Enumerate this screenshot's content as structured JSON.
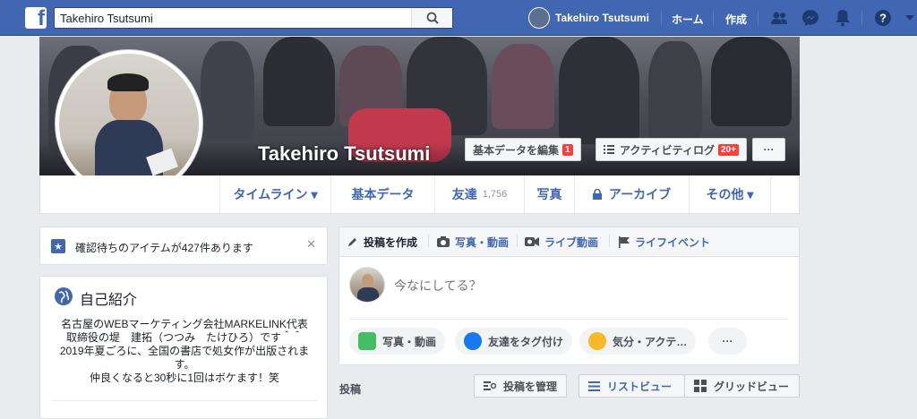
{
  "topbar": {
    "logo": "f",
    "search_value": "Takehiro Tsutsumi",
    "profile_name": "Takehiro Tsutsumi",
    "home_label": "ホーム",
    "create_label": "作成",
    "icons": [
      "search-icon",
      "friends-icon",
      "messenger-icon",
      "notifications-icon",
      "help-icon",
      "caret-down-icon"
    ]
  },
  "cover": {
    "name": "Takehiro Tsutsumi",
    "edit_button": "基本データを編集",
    "edit_badge": "1",
    "activity_button": "アクティビティログ",
    "activity_badge": "20+",
    "more_button": "···"
  },
  "nav": {
    "items": [
      {
        "label": "タイムライン ▾"
      },
      {
        "label": "基本データ"
      },
      {
        "label": "友達",
        "count": "1,756"
      },
      {
        "label": "写真"
      },
      {
        "label": "アーカイブ"
      },
      {
        "label": "その他 ▾"
      }
    ]
  },
  "pending": {
    "text": "確認待ちのアイテムが427件あります",
    "close": "✕"
  },
  "intro": {
    "title": "自己紹介",
    "bio": [
      "名古屋のWEBマーケティング会社MARKELINK代表",
      "取締役の堤　建拓（つつみ　たけひろ）です＾＾",
      "2019年夏ごろに、全国の書店で処女作が出版されま",
      "す。",
      "仲良くなると30秒に1回はボケます！笑"
    ]
  },
  "composer": {
    "tabs": [
      "投稿を作成",
      "写真・動画",
      "ライブ動画",
      "ライフイベント"
    ],
    "placeholder": "今なにしてる？",
    "chips": [
      "写真・動画",
      "友達をタグ付け",
      "気分・アクテ…",
      "···"
    ]
  },
  "posts_bar": {
    "label": "投稿",
    "manage": "投稿を管理",
    "list_view": "リストビュー",
    "grid_view": "グリッドビュー"
  },
  "colors": {
    "brand": "#4267b2",
    "badge": "#fa3e3e",
    "page_bg": "#e9ebee"
  }
}
